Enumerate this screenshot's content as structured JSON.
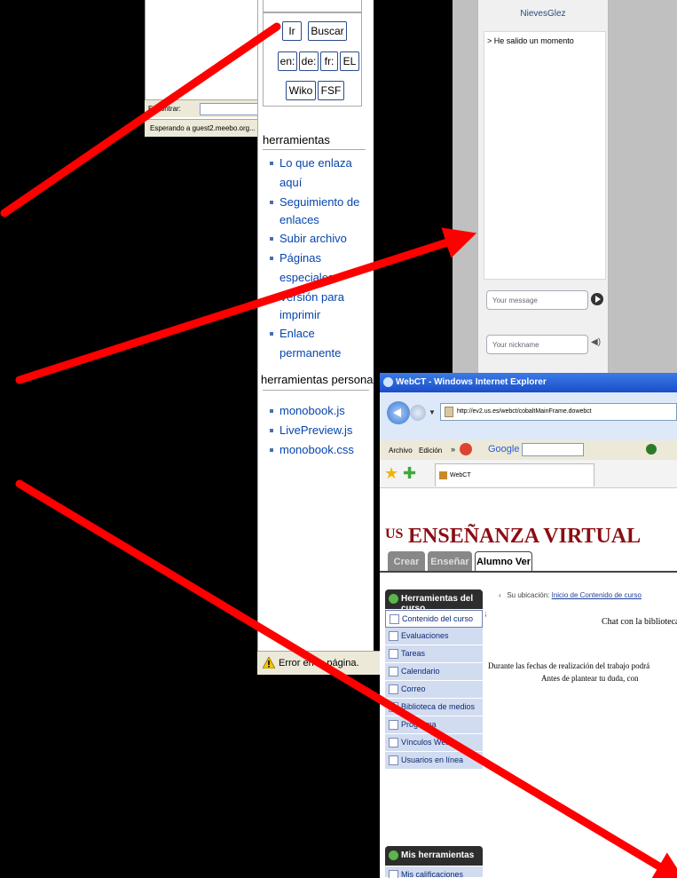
{
  "left_browser": {
    "find_label": "Encontrar:",
    "status_text": "Esperando a guest2.meebo.org..."
  },
  "wiki": {
    "buttons": {
      "go": "Ir",
      "search": "Buscar",
      "lang_en": "en:",
      "lang_de": "de:",
      "lang_fr": "fr:",
      "lang_el": "EL",
      "wiko": "Wiko",
      "fsf": "FSF"
    },
    "tools_title": "herramientas",
    "tools": [
      "Lo que enlaza aquí",
      "Seguimiento de enlaces",
      "Subir archivo",
      "Páginas especiales",
      "Versión para imprimir",
      "Enlace permanente"
    ],
    "personal_title": "herramientas personales",
    "personal": [
      "monobook.js",
      "LivePreview.js",
      "monobook.css"
    ],
    "error_text": "Error en la página."
  },
  "chat": {
    "user": "NievesGlez",
    "message": "> He salido un momento",
    "message_placeholder": "Your message",
    "nickname_placeholder": "Your nickname"
  },
  "ie": {
    "title": "WebCT - Windows Internet Explorer",
    "url": "http://ev2.us.es/webct/cobaltMainFrame.dowebct",
    "menu_archivo": "Archivo",
    "menu_edicion": "Edición",
    "google": "Google",
    "tab_label": "WebCT"
  },
  "webct": {
    "banner_title": "ENSEÑANZA VIRTUAL",
    "logo": "US",
    "tabs": [
      "Crear",
      "Enseñar",
      "Alumno Ver"
    ],
    "course_tools_header": "Herramientas del curso",
    "course_tools": [
      "Contenido del curso",
      "Evaluaciones",
      "Tareas",
      "Calendario",
      "Correo",
      "Biblioteca de medios",
      "Programa",
      "Vínculos Web",
      "Usuarios en línea"
    ],
    "my_tools_header": "Mis herramientas",
    "my_tools_first": "Mis calificaciones",
    "location_label": "Su ubicación:",
    "location_link": "Inicio de Contenido de curso",
    "chat_title": "Chat con la biblioteca",
    "text1": "Durante las fechas de realización del trabajo podrá",
    "text2": "Antes de plantear tu duda, con"
  },
  "colors": {
    "arrow": "#ff0000",
    "banner": "#8b0d12",
    "wiki_link": "#0645ad"
  }
}
